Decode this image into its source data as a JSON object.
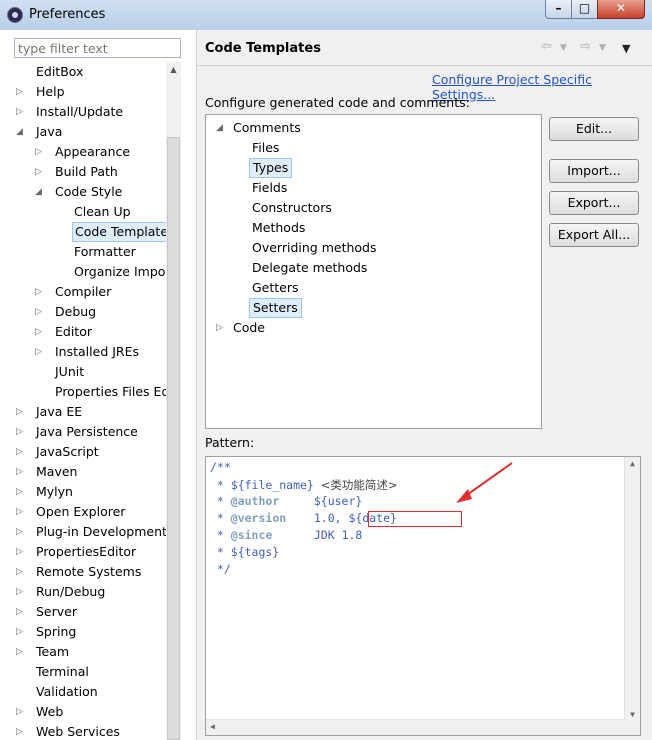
{
  "window": {
    "title": "Preferences"
  },
  "filter": {
    "placeholder": "type filter text"
  },
  "sidebar": {
    "items": [
      {
        "label": "EditBox",
        "level": 1,
        "arrow": "none"
      },
      {
        "label": "Help",
        "level": 1,
        "arrow": "collapsed"
      },
      {
        "label": "Install/Update",
        "level": 1,
        "arrow": "collapsed"
      },
      {
        "label": "Java",
        "level": 1,
        "arrow": "expanded"
      },
      {
        "label": "Appearance",
        "level": 2,
        "arrow": "collapsed"
      },
      {
        "label": "Build Path",
        "level": 2,
        "arrow": "collapsed"
      },
      {
        "label": "Code Style",
        "level": 2,
        "arrow": "expanded"
      },
      {
        "label": "Clean Up",
        "level": 3,
        "arrow": "none"
      },
      {
        "label": "Code Templates",
        "level": 3,
        "arrow": "none",
        "selected": true
      },
      {
        "label": "Formatter",
        "level": 3,
        "arrow": "none"
      },
      {
        "label": "Organize Imports",
        "level": 3,
        "arrow": "none"
      },
      {
        "label": "Compiler",
        "level": 2,
        "arrow": "collapsed"
      },
      {
        "label": "Debug",
        "level": 2,
        "arrow": "collapsed"
      },
      {
        "label": "Editor",
        "level": 2,
        "arrow": "collapsed"
      },
      {
        "label": "Installed JREs",
        "level": 2,
        "arrow": "collapsed"
      },
      {
        "label": "JUnit",
        "level": 2,
        "arrow": "none"
      },
      {
        "label": "Properties Files Editor",
        "level": 2,
        "arrow": "none"
      },
      {
        "label": "Java EE",
        "level": 1,
        "arrow": "collapsed"
      },
      {
        "label": "Java Persistence",
        "level": 1,
        "arrow": "collapsed"
      },
      {
        "label": "JavaScript",
        "level": 1,
        "arrow": "collapsed"
      },
      {
        "label": "Maven",
        "level": 1,
        "arrow": "collapsed"
      },
      {
        "label": "Mylyn",
        "level": 1,
        "arrow": "collapsed"
      },
      {
        "label": "Open Explorer",
        "level": 1,
        "arrow": "collapsed"
      },
      {
        "label": "Plug-in Development",
        "level": 1,
        "arrow": "collapsed"
      },
      {
        "label": "PropertiesEditor",
        "level": 1,
        "arrow": "collapsed"
      },
      {
        "label": "Remote Systems",
        "level": 1,
        "arrow": "collapsed"
      },
      {
        "label": "Run/Debug",
        "level": 1,
        "arrow": "collapsed"
      },
      {
        "label": "Server",
        "level": 1,
        "arrow": "collapsed"
      },
      {
        "label": "Spring",
        "level": 1,
        "arrow": "collapsed"
      },
      {
        "label": "Team",
        "level": 1,
        "arrow": "collapsed"
      },
      {
        "label": "Terminal",
        "level": 1,
        "arrow": "none"
      },
      {
        "label": "Validation",
        "level": 1,
        "arrow": "none"
      },
      {
        "label": "Web",
        "level": 1,
        "arrow": "collapsed"
      },
      {
        "label": "Web Services",
        "level": 1,
        "arrow": "collapsed"
      }
    ]
  },
  "page": {
    "title": "Code Templates",
    "configure_link": "Configure Project Specific Settings...",
    "description": "Configure generated code and comments:",
    "pattern_label": "Pattern:"
  },
  "templates": {
    "items": [
      {
        "label": "Comments",
        "level": 0,
        "arrow": "expanded"
      },
      {
        "label": "Files",
        "level": 1,
        "arrow": "none"
      },
      {
        "label": "Types",
        "level": 1,
        "arrow": "none",
        "selected": true
      },
      {
        "label": "Fields",
        "level": 1,
        "arrow": "none"
      },
      {
        "label": "Constructors",
        "level": 1,
        "arrow": "none"
      },
      {
        "label": "Methods",
        "level": 1,
        "arrow": "none"
      },
      {
        "label": "Overriding methods",
        "level": 1,
        "arrow": "none"
      },
      {
        "label": "Delegate methods",
        "level": 1,
        "arrow": "none"
      },
      {
        "label": "Getters",
        "level": 1,
        "arrow": "none"
      },
      {
        "label": "Setters",
        "level": 1,
        "arrow": "none",
        "selected": true
      },
      {
        "label": "Code",
        "level": 0,
        "arrow": "collapsed"
      }
    ]
  },
  "buttons": {
    "edit": "Edit...",
    "import": "Import...",
    "export": "Export...",
    "export_all": "Export All..."
  },
  "pattern": {
    "line1": "/**",
    "line2_prefix": " * ${file_name} ",
    "line2_cn": "<类功能简述>",
    "line3_prefix": " * ",
    "line3_tag": "@author",
    "line3_value": "     ${user}",
    "line4_prefix": " * ",
    "line4_tag": "@version",
    "line4_value": "    1.0, ${date}",
    "line5_prefix": " * ",
    "line5_tag": "@since",
    "line5_value": "      JDK 1.8",
    "line6": " * ${tags}",
    "line7": " */"
  },
  "colors": {
    "annotation_arrow": "#e03030",
    "link": "#2255cc",
    "javadoc": "#3f5fbf",
    "javadoc_tag": "#7f9fbf",
    "selection": "#dfeefc"
  },
  "icons": [
    "eclipse-app-icon",
    "back-arrow-icon",
    "forward-arrow-icon",
    "view-menu-icon"
  ]
}
